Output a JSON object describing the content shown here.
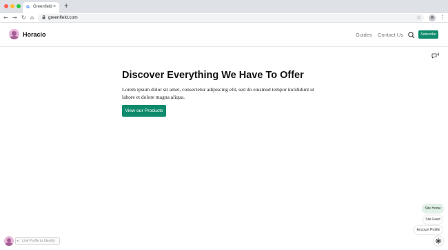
{
  "browser": {
    "tab_title": "Greenfield",
    "tab_favicon": "G",
    "url": "greenfield.com",
    "new_tab_symbol": "+",
    "close_symbol": "×"
  },
  "site": {
    "brand": "Horacio",
    "nav": [
      {
        "label": "Guides"
      },
      {
        "label": "Contact Us"
      }
    ],
    "subscribe_label": "Subscribe",
    "comment_count": "4",
    "accent_color": "#0e8b6c"
  },
  "hero": {
    "title": "Discover Everything We Have To Offer",
    "text": "Lorem ipsum dolor sit amet, consectetur adipiscing elit, sed do eiusmod tempor incididunt ut labore et dolore magna aliqua.",
    "cta_label": "View our Products"
  },
  "floating_menu": {
    "items": [
      {
        "label": "Site Home"
      },
      {
        "label": "Site Feed"
      },
      {
        "label": "Account Profile"
      }
    ]
  },
  "link_profile": {
    "label": "Link Profile to Identity"
  },
  "icons": [
    "back-arrow-icon",
    "forward-arrow-icon",
    "reload-icon",
    "home-icon",
    "lock-icon",
    "bookmark-star-icon",
    "profile-icon",
    "kebab-menu-icon",
    "search-icon",
    "comment-icon",
    "asterisk-icon"
  ]
}
